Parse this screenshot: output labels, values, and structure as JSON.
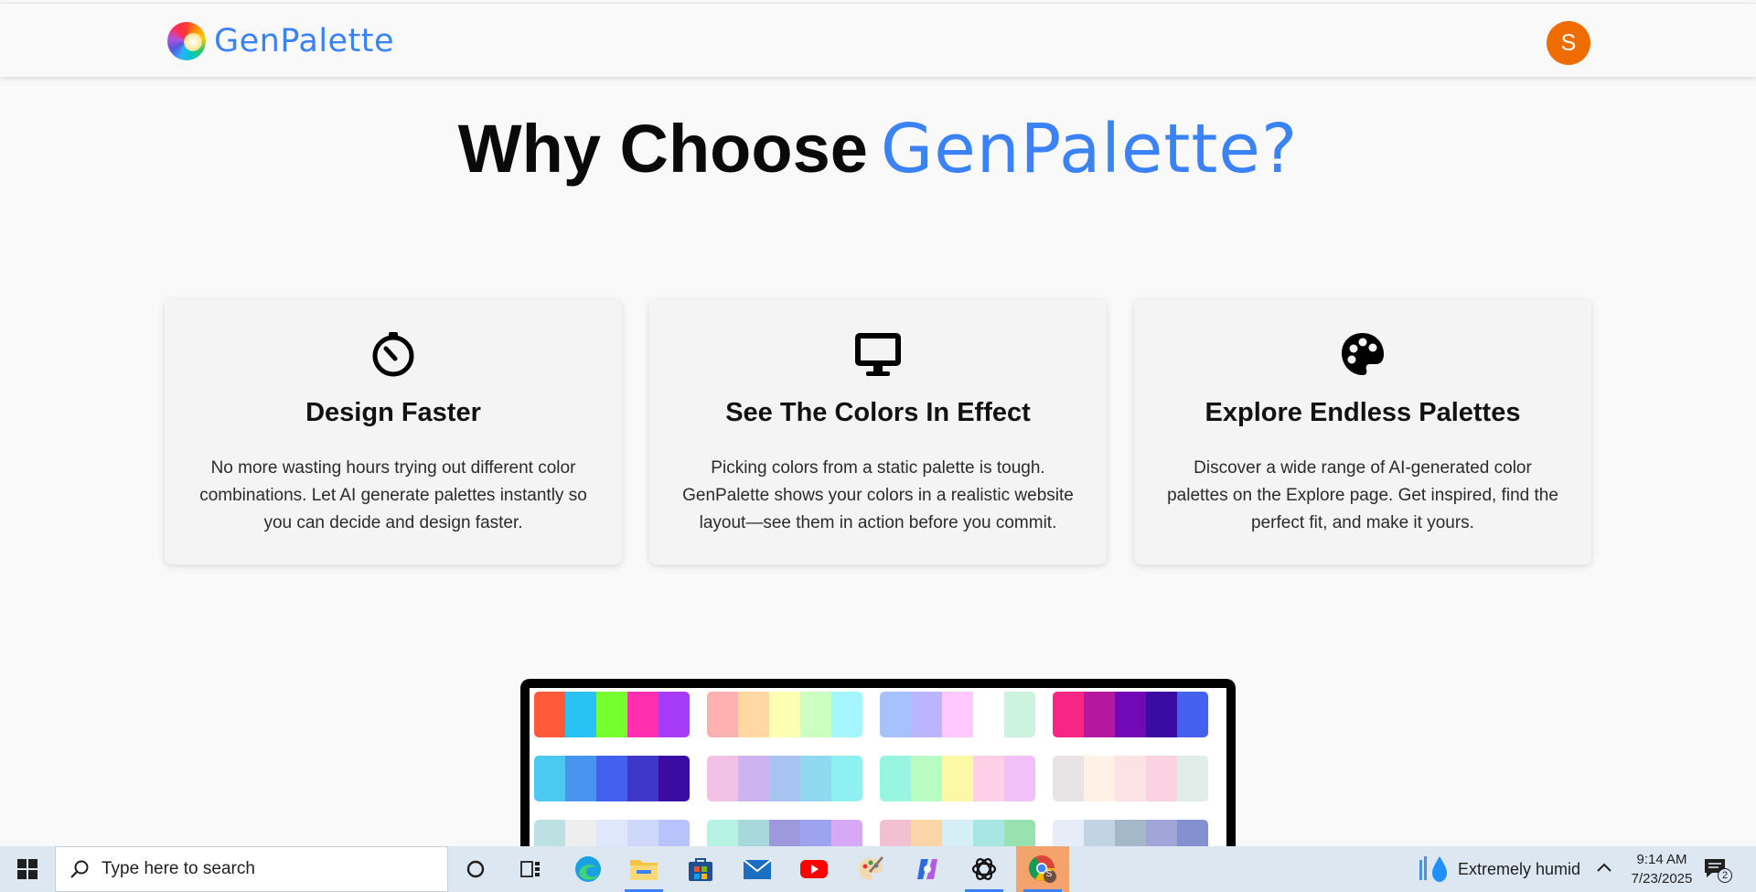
{
  "header": {
    "logo_text": "GenPalette",
    "avatar_initial": "S"
  },
  "hero": {
    "title_prefix": "Why Choose",
    "title_brand": "GenPalette?"
  },
  "features": [
    {
      "icon": "timer-icon",
      "title": "Design Faster",
      "description": "No more wasting hours trying out different color combinations. Let AI generate palettes instantly so you can decide and design faster."
    },
    {
      "icon": "monitor-icon",
      "title": "See The Colors In Effect",
      "description": "Picking colors from a static palette is tough. GenPalette shows your colors in a realistic website layout—see them in action before you commit."
    },
    {
      "icon": "palette-icon",
      "title": "Explore Endless Palettes",
      "description": "Discover a wide range of AI-generated color palettes on the Explore page. Get inspired, find the perfect fit, and make it yours."
    }
  ],
  "palette_preview": [
    [
      "#ff5a3a",
      "#29c2f5",
      "#76ff2e",
      "#ff2faf",
      "#a63cf7"
    ],
    [
      "#ffb0b0",
      "#ffd8a4",
      "#fdffb3",
      "#ccffc2",
      "#a3f5ff"
    ],
    [
      "#a5c2ff",
      "#bdb4ff",
      "#ffc8ff",
      "#ffffff",
      "#cbf3e0"
    ],
    [
      "#f72585",
      "#b5179e",
      "#7209b7",
      "#3a0ca3",
      "#4361ee"
    ],
    [
      "#4cc9f0",
      "#4895ef",
      "#4361ee",
      "#3f37c9",
      "#3a0ca3"
    ],
    [
      "#f2c1e6",
      "#cdb4f0",
      "#a8c3f0",
      "#90d8f0",
      "#8ef0f0"
    ],
    [
      "#98f5e1",
      "#b9fbc0",
      "#fbf8a6",
      "#ffcfe8",
      "#f1c0f9"
    ],
    [
      "#e8e4e6",
      "#fff1e6",
      "#fde2e4",
      "#fad2e1",
      "#e2ece9"
    ],
    [
      "#bde0e2",
      "#eeeeee",
      "#dfe7fd",
      "#cdd8fb",
      "#b8c2fb"
    ],
    [
      "#b5f2e3",
      "#a8d8dc",
      "#9e99dd",
      "#9ea3f0",
      "#d7a8f5"
    ],
    [
      "#f2c1d1",
      "#f9d5a7",
      "#d6eff7",
      "#a8e6e3",
      "#98e2b0"
    ],
    [
      "#e6edf8",
      "#c2d3e4",
      "#a4b8c9",
      "#a0a6d8",
      "#8490d0"
    ]
  ],
  "taskbar": {
    "search_placeholder": "Type here to search",
    "weather": "Extremely humid",
    "time": "9:14 AM",
    "date": "7/23/2025",
    "notification_count": "2",
    "chrome_badge": "S"
  }
}
